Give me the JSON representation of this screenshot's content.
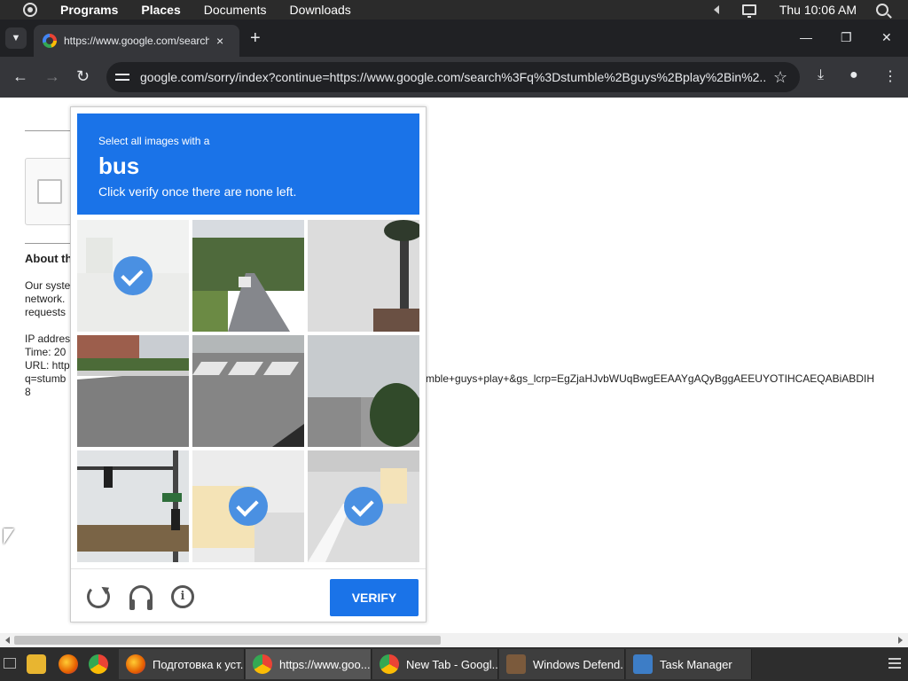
{
  "top_panel": {
    "programs": "Programs",
    "places": "Places",
    "documents": "Documents",
    "downloads": "Downloads",
    "clock": "Thu 10:06 AM"
  },
  "browser": {
    "tab_title": "https://www.google.com/search?q=stumble+guys+play+in",
    "tab_close": "×",
    "new_tab": "+",
    "window_controls": {
      "minimize": "—",
      "restore": "❐",
      "close": "✕"
    },
    "nav": {
      "back": "←",
      "forward": "→",
      "reload": "↻"
    },
    "url": "google.com/sorry/index?continue=https://www.google.com/search%3Fq%3Dstumble%2Bguys%2Bplay%2Bin%2...",
    "star": "☆",
    "download": "⤓",
    "profile": "●",
    "menu": "⋮"
  },
  "page": {
    "about_heading": "About th",
    "para_lines": [
      "Our syste",
      "network.",
      "requests"
    ],
    "ip_lines": [
      "IP addres",
      "Time: 20",
      "URL: http",
      "q=stumb",
      "8"
    ],
    "url_tail": "mble+guys+play+&gs_lcrp=EgZjaHJvbWUqBwgEEAAYgAQyBggAEEUYOTIHCAEQABiABDIH"
  },
  "captcha": {
    "instruction": "Select all images with a",
    "target_word": "bus",
    "subtext": "Click verify once there are none left.",
    "selected_tiles": [
      0,
      7,
      8
    ],
    "verify_label": "VERIFY",
    "info_glyph": "i"
  },
  "taskbar": {
    "tasks": [
      {
        "label": "Подготовка к уст...",
        "icon": "firefox-icon"
      },
      {
        "label": "https://www.goo...",
        "icon": "chrome-icon"
      },
      {
        "label": "New Tab - Googl...",
        "icon": "chrome-icon"
      },
      {
        "label": "Windows Defend...",
        "icon": "defender-icon"
      },
      {
        "label": "Task Manager",
        "icon": "task-manager-icon"
      }
    ]
  },
  "colors": {
    "captcha_blue": "#1a73e8",
    "check_blue": "#4a90e2"
  }
}
